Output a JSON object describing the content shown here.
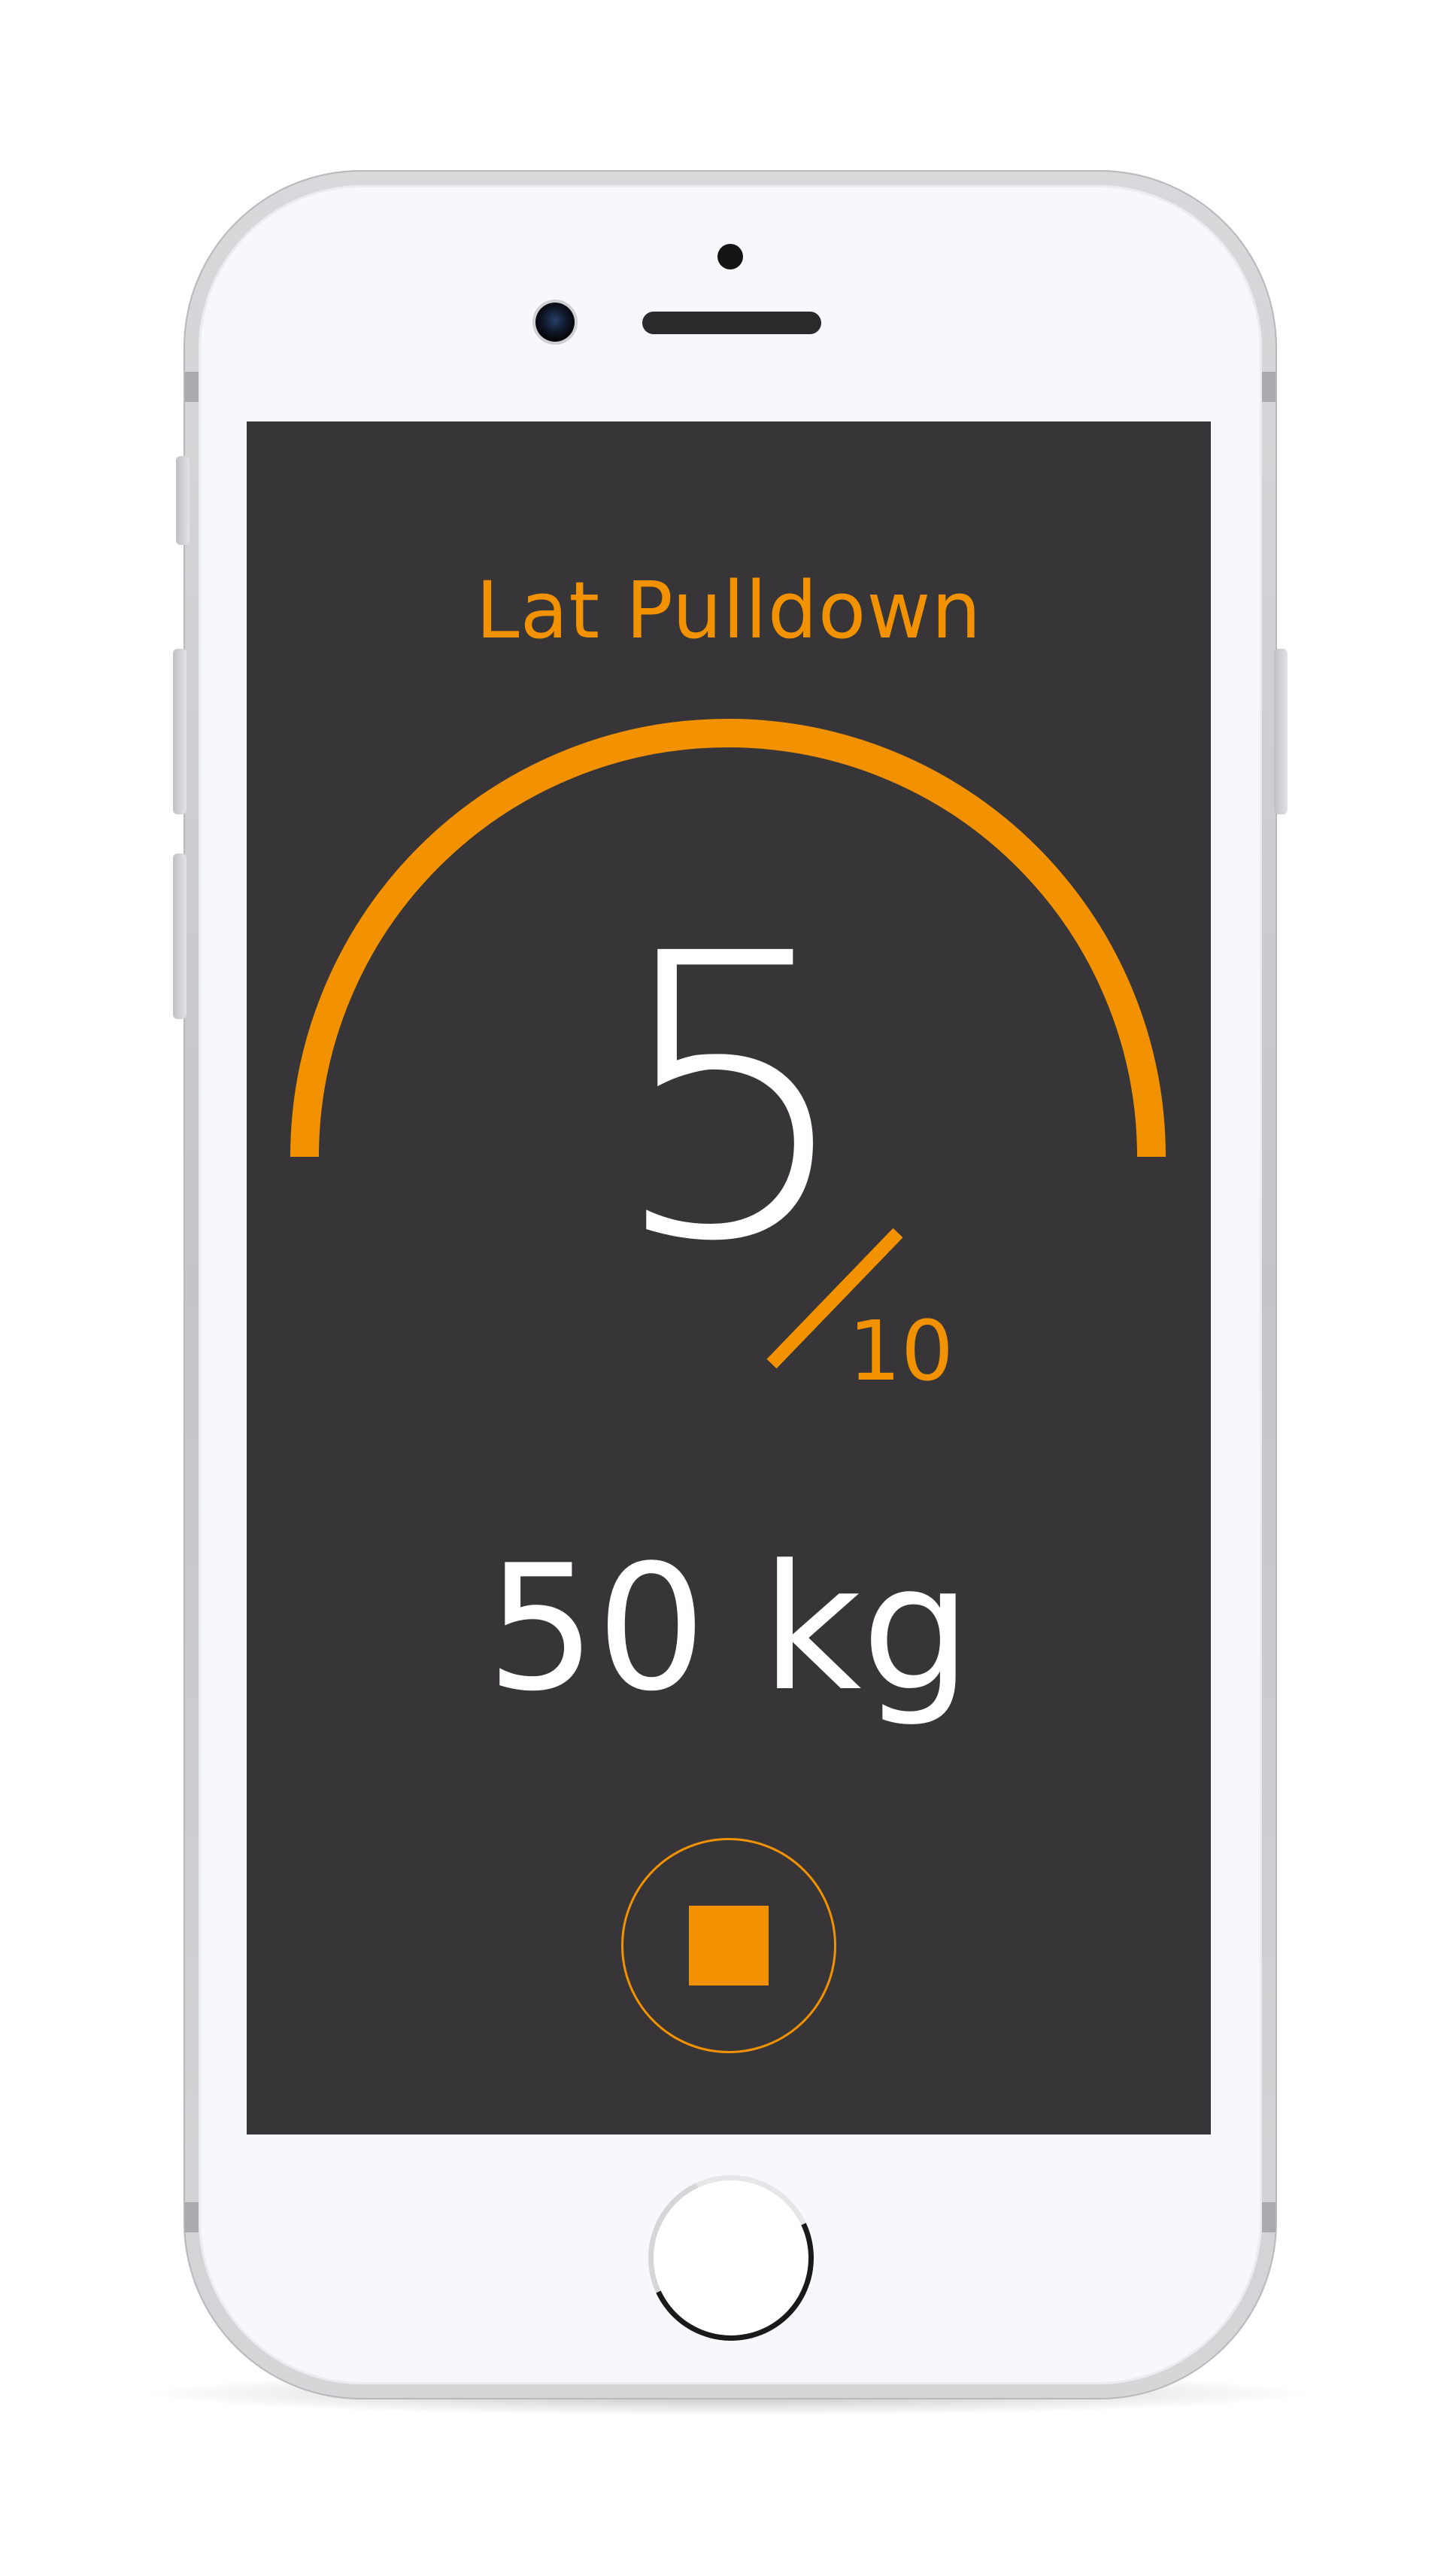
{
  "workout": {
    "exercise_name": "Lat Pulldown",
    "reps_completed": "5",
    "reps_total": "10",
    "reps_progress": 0.5,
    "weight": "50 kg"
  },
  "controls": {
    "stop_icon": "stop-square-icon"
  },
  "colors": {
    "accent": "#f39200",
    "screen_background": "#373537",
    "text_primary": "#ffffff"
  }
}
